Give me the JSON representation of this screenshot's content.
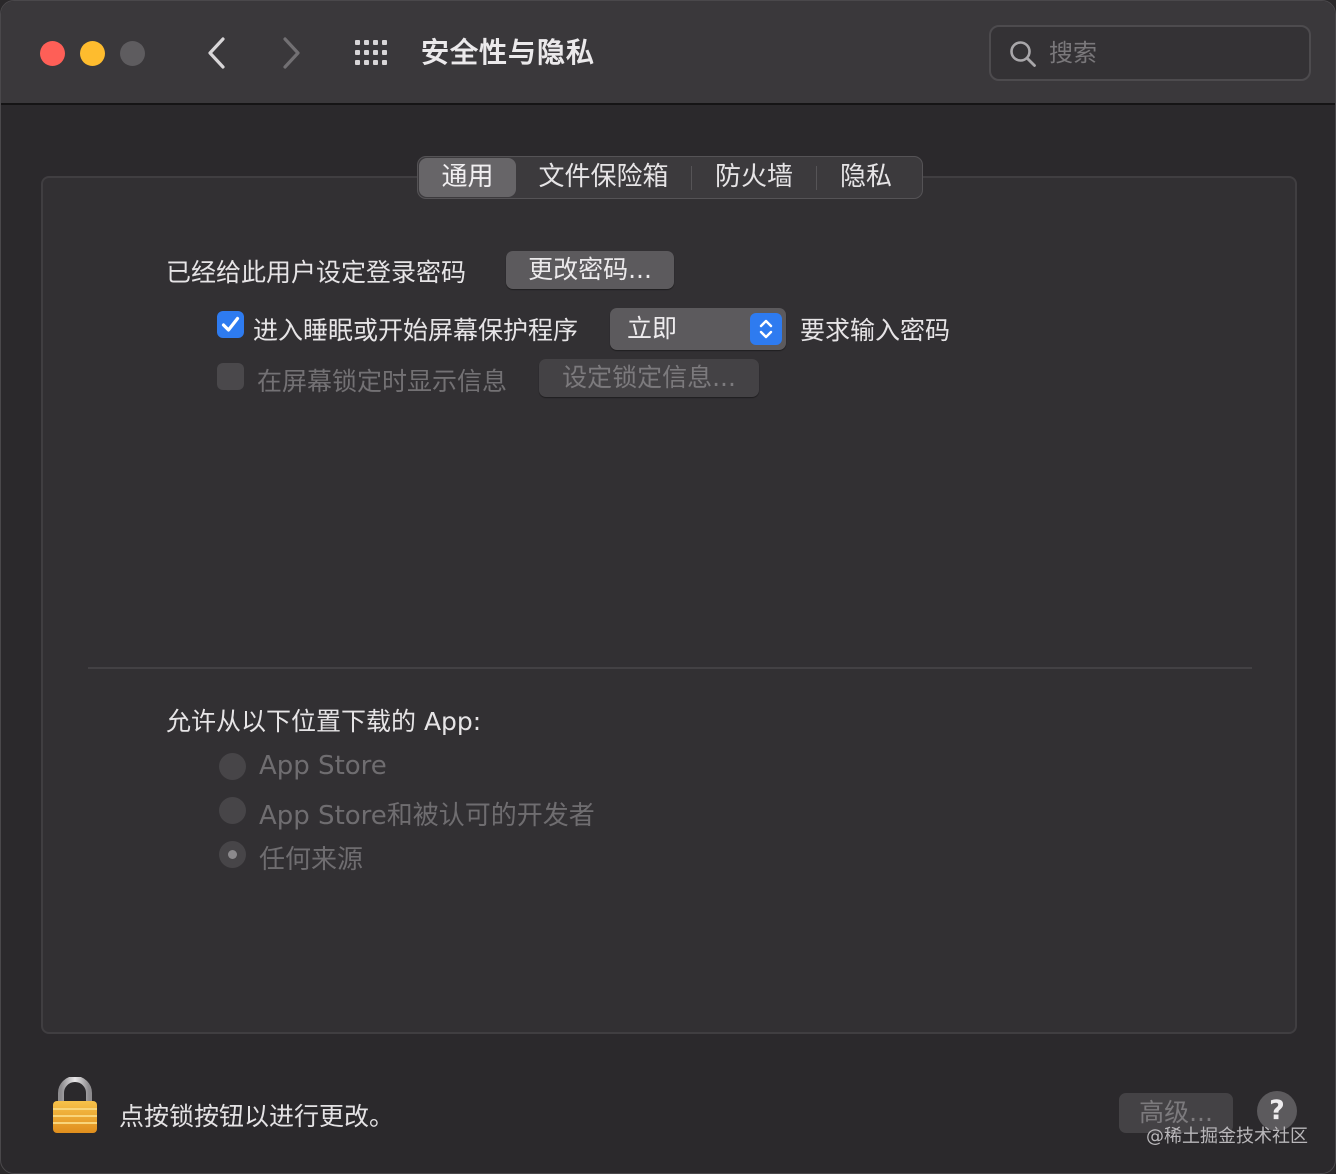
{
  "window": {
    "title": "安全性与隐私",
    "search_placeholder": "搜索"
  },
  "tabs": [
    {
      "label": "通用",
      "active": true
    },
    {
      "label": "文件保险箱",
      "active": false
    },
    {
      "label": "防火墙",
      "active": false
    },
    {
      "label": "隐私",
      "active": false
    }
  ],
  "general": {
    "password_set_label": "已经给此用户设定登录密码",
    "change_password_button": "更改密码...",
    "require_password": {
      "checked": true,
      "label": "进入睡眠或开始屏幕保护程序",
      "delay_value": "立即",
      "suffix": "要求输入密码"
    },
    "lock_message": {
      "checked": false,
      "enabled": false,
      "label": "在屏幕锁定时显示信息",
      "button": "设定锁定信息..."
    }
  },
  "downloads": {
    "heading": "允许从以下位置下载的 App:",
    "options": [
      {
        "label": "App Store",
        "selected": false
      },
      {
        "label": "App Store和被认可的开发者",
        "selected": false
      },
      {
        "label": "任何来源",
        "selected": true
      }
    ]
  },
  "footer": {
    "lock_text": "点按锁按钮以进行更改。",
    "advanced_button": "高级...",
    "help_button": "?"
  },
  "watermark": "@稀土掘金技术社区",
  "colors": {
    "accent": "#2e7bf0",
    "close": "#fe5f57",
    "minimize": "#febc2e"
  }
}
